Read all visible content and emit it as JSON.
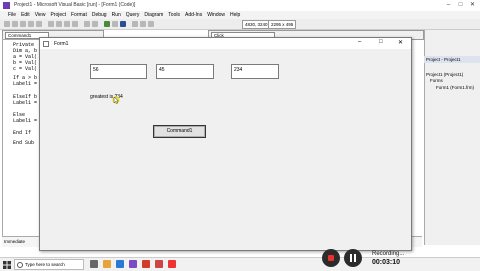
{
  "ide": {
    "title": "Project1 - Microsoft Visual Basic [run] - [Form1 (Code)]"
  },
  "menu": [
    "File",
    "Edit",
    "View",
    "Project",
    "Format",
    "Debug",
    "Run",
    "Query",
    "Diagram",
    "Tools",
    "Add-Ins",
    "Window",
    "Help"
  ],
  "toolbar": {
    "position": "4830, 3240",
    "size": "2295 x 495"
  },
  "code": {
    "object_combo": "Command1",
    "proc_combo": "Click",
    "lines": [
      "Private",
      "Dim a, b",
      "a = Val(",
      "b = Val(",
      "c = Val(",
      "",
      "If a > b",
      "Label1 =",
      "",
      "ElseIf b",
      "Label1 =",
      "",
      "Else",
      "Label1 =",
      "",
      "End If",
      "",
      "End Sub"
    ]
  },
  "project": {
    "panel_title": "Project - Project1",
    "tree": [
      "Project1 (Project1)",
      "Forms",
      "Form1 (Form1.frm)"
    ]
  },
  "form": {
    "title": "Form1",
    "text1": "56",
    "text2": "45",
    "text3": "234",
    "label": "greatest is 234",
    "button": "Command1"
  },
  "immediate": {
    "title": "Immediate"
  },
  "taskbar": {
    "search_placeholder": "Type here to search"
  },
  "recording": {
    "label": "Recording...",
    "time": "00:03:10"
  }
}
